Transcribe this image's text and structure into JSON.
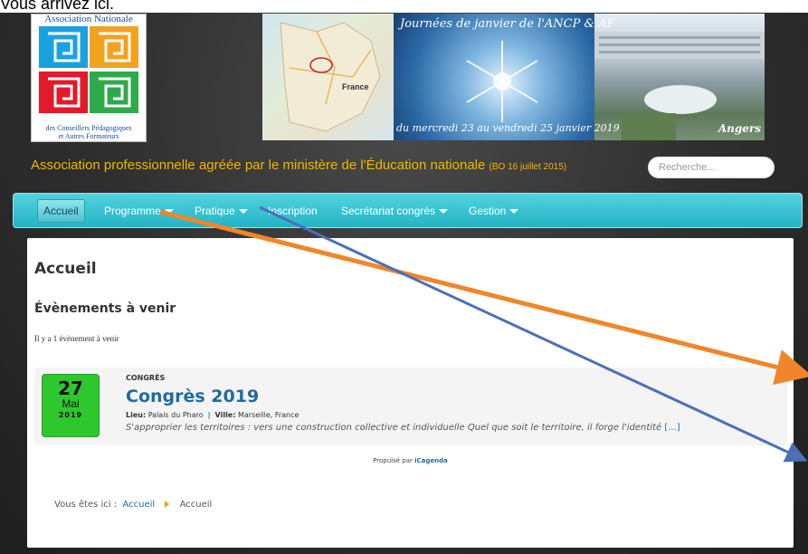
{
  "top_text": "Vous arrivez ici.",
  "logo": {
    "top": "Association Nationale",
    "bottom_line1": "des Conseillers Pédagogiques",
    "bottom_line2": "et Autres Formateurs"
  },
  "banner": {
    "title": "Journées de janvier de l'ANCP & AF",
    "dates": "du mercredi 23 au vendredi 25 janvier 2019",
    "city": "Angers",
    "map_label": "France"
  },
  "tagline": {
    "main": "Association professionnelle agréée par le ministère de l'Éducation nationale",
    "small": "(BO 16 juillet 2015)"
  },
  "search": {
    "placeholder": "Recherche..."
  },
  "nav": {
    "items": [
      {
        "label": "Accueil"
      },
      {
        "label": "Programme"
      },
      {
        "label": "Pratique"
      },
      {
        "label": "Inscription"
      },
      {
        "label": "Secrétariat congrès"
      },
      {
        "label": "Gestion"
      }
    ]
  },
  "main": {
    "page_title": "Accueil",
    "section_title": "Évènements à venir",
    "count_text": "Il y a 1 évènement à venir",
    "event": {
      "day": "27",
      "month": "Mai",
      "year": "2019",
      "category": "CONGRÈS",
      "title": "Congrès 2019",
      "lieu_label": "Lieu:",
      "lieu": "Palais du Pharo",
      "sep": "|",
      "ville_label": "Ville:",
      "ville": "Marseille, France",
      "description": "S'approprier les territoires : vers une construction collective et individuelle Quel que soit le territoire, il forge l'identité",
      "more": "[...]"
    },
    "powered_prefix": "Propulsé par",
    "powered_brand": "iCagenda"
  },
  "breadcrumb": {
    "prefix": "Vous êtes ici :",
    "link": "Accueil",
    "current": "Accueil"
  },
  "colors": {
    "nav": "#22b4c4",
    "accent": "#f2b600",
    "link": "#1f6ba0",
    "date_box": "#2ec82e",
    "arrow_orange": "#f0862a",
    "arrow_blue": "#4a70b8"
  }
}
